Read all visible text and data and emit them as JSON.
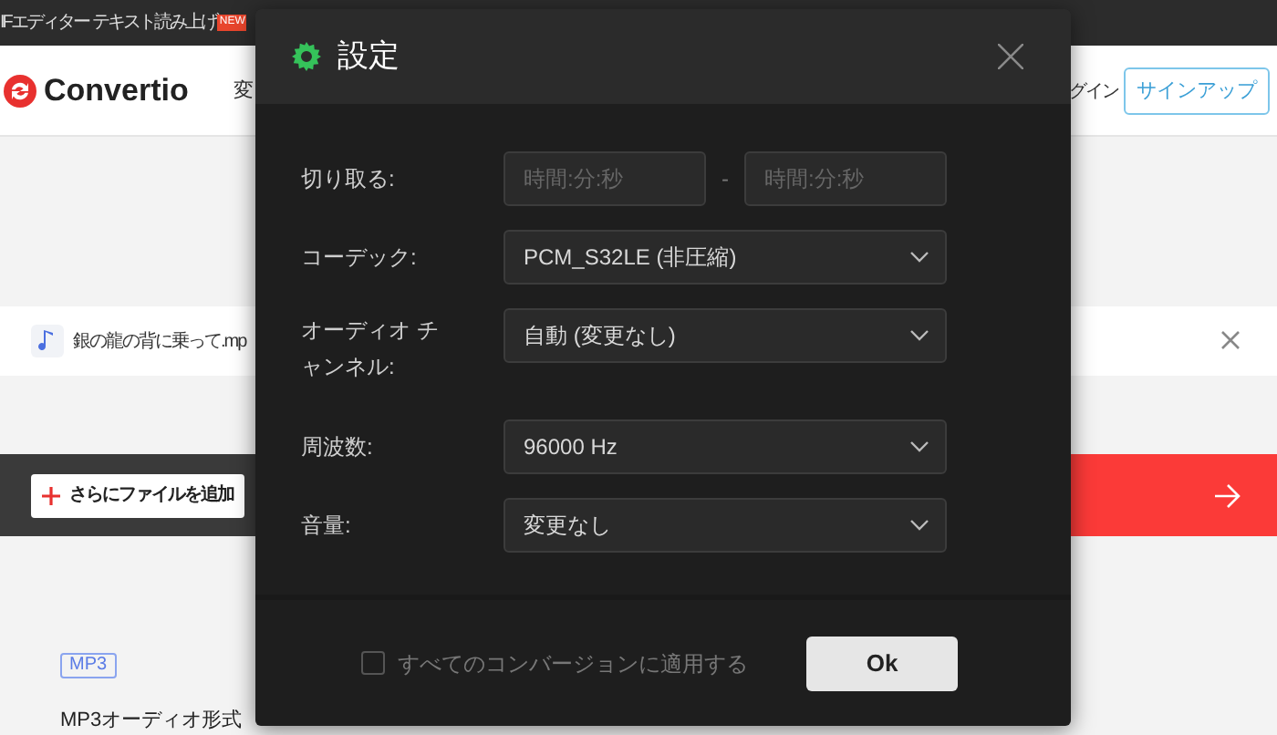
{
  "top_bar": {
    "links": [
      {
        "label": "IFエディター"
      },
      {
        "label": "テキスト読み上げ",
        "badge": "NEW"
      }
    ]
  },
  "header": {
    "logo": "Convertio",
    "nav_item": "変",
    "login": "グイン",
    "signup": "サインアップ"
  },
  "file_row": {
    "name": "銀の龍の背に乗って.mp"
  },
  "actions": {
    "add_files": "さらにファイルを追加"
  },
  "format": {
    "tag": "MP3",
    "description": "MP3オーディオ形式"
  },
  "dialog": {
    "title": "設定",
    "fields": [
      {
        "kind": "range",
        "label": "切り取る:",
        "from_placeholder": "時間:分:秒",
        "separator": "-",
        "to_placeholder": "時間:分:秒"
      },
      {
        "kind": "select",
        "label": "コーデック:",
        "value": "PCM_S32LE (非圧縮)"
      },
      {
        "kind": "select",
        "label": "オーディオ チャンネル:",
        "value": "自動 (変更なし)"
      },
      {
        "kind": "select",
        "label": "周波数:",
        "value": "96000 Hz"
      },
      {
        "kind": "select",
        "label": "音量:",
        "value": "変更なし"
      }
    ],
    "apply_all": {
      "label": "すべてのコンバージョンに適用する",
      "checked": false
    },
    "ok": "Ok"
  }
}
